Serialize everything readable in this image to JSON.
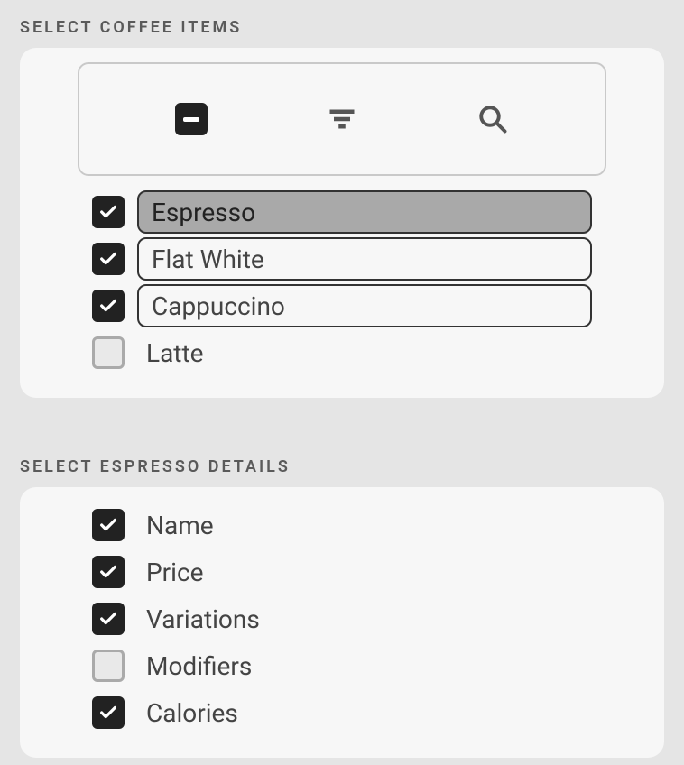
{
  "section1": {
    "title": "Select Coffee Items",
    "toolbar": {
      "indeterminate": true
    },
    "items": [
      {
        "label": "Espresso",
        "checked": true,
        "boxed": true,
        "selected": true
      },
      {
        "label": "Flat White",
        "checked": true,
        "boxed": true,
        "selected": false
      },
      {
        "label": "Cappuccino",
        "checked": true,
        "boxed": true,
        "selected": false
      },
      {
        "label": "Latte",
        "checked": false,
        "boxed": false,
        "selected": false
      }
    ]
  },
  "section2": {
    "title": "Select Espresso Details",
    "items": [
      {
        "label": "Name",
        "checked": true
      },
      {
        "label": "Price",
        "checked": true
      },
      {
        "label": "Variations",
        "checked": true
      },
      {
        "label": "Modifiers",
        "checked": false
      },
      {
        "label": "Calories",
        "checked": true
      }
    ]
  }
}
